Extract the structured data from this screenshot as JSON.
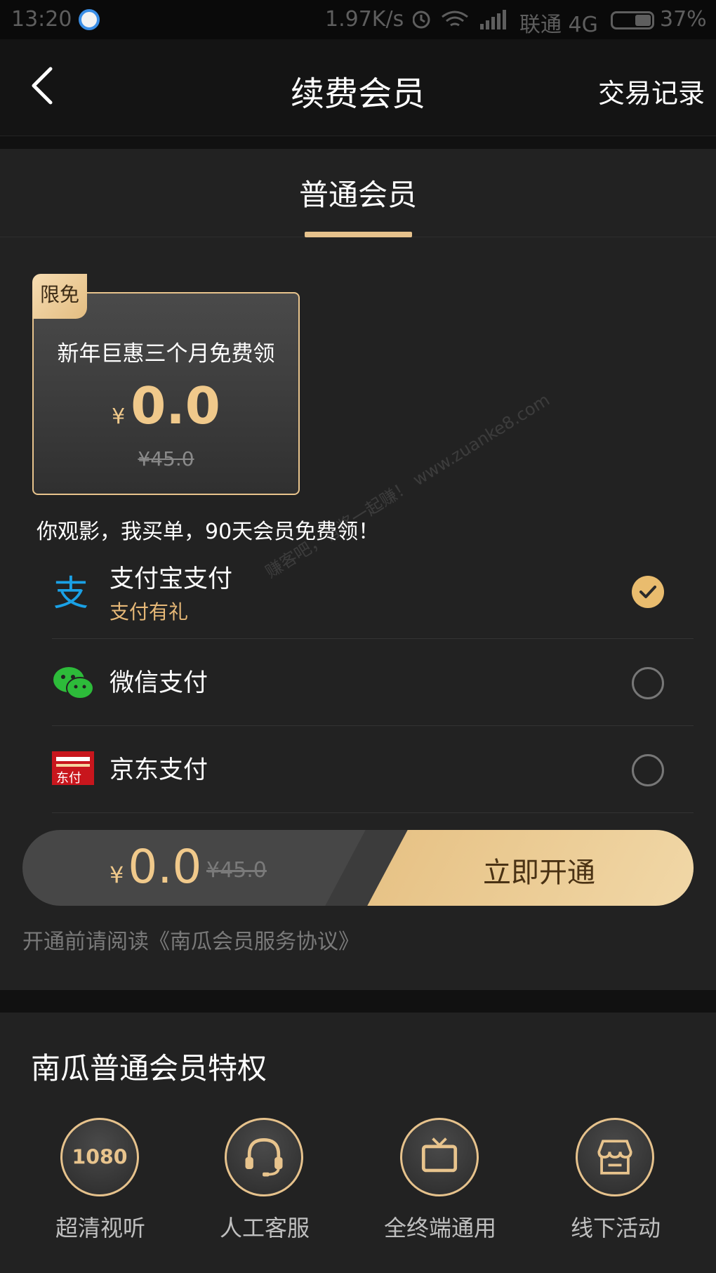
{
  "status_bar": {
    "time": "13:20",
    "net_speed": "1.97K/s",
    "carrier": "联通 4G",
    "battery": "37%"
  },
  "navbar": {
    "title": "续费会员",
    "right_link": "交易记录"
  },
  "tab": {
    "label": "普通会员"
  },
  "plan": {
    "badge": "限免",
    "name": "新年巨惠三个月免费领",
    "currency": "¥",
    "price": "0.0",
    "original_price": "¥45.0"
  },
  "promo_text": "你观影，我买单，90天会员免费领！",
  "payment_methods": [
    {
      "name": "支付宝支付",
      "subtitle": "支付有礼",
      "selected": true,
      "icon": "alipay-icon"
    },
    {
      "name": "微信支付",
      "subtitle": "",
      "selected": false,
      "icon": "wechat-icon"
    },
    {
      "name": "京东支付",
      "subtitle": "",
      "selected": false,
      "icon": "jdpay-icon"
    }
  ],
  "purchase": {
    "currency": "¥",
    "price": "0.0",
    "original_price": "¥45.0",
    "button_label": "立即开通"
  },
  "agreement": {
    "prefix": "开通前请阅读",
    "link": "《南瓜会员服务协议》"
  },
  "privileges": {
    "title": "南瓜普通会员特权",
    "items": [
      {
        "label": "超清视听",
        "icon": "hd-1080-icon",
        "icon_text": "1080"
      },
      {
        "label": "人工客服",
        "icon": "headset-icon"
      },
      {
        "label": "全终端通用",
        "icon": "tv-icon"
      },
      {
        "label": "线下活动",
        "icon": "store-icon"
      }
    ]
  },
  "watermark": "赚客吧，有奖一起赚！ www.zuanke8.com",
  "colors": {
    "accent_gold": "#e6c28c",
    "price_gold": "#f0c98b",
    "background": "#222222"
  }
}
